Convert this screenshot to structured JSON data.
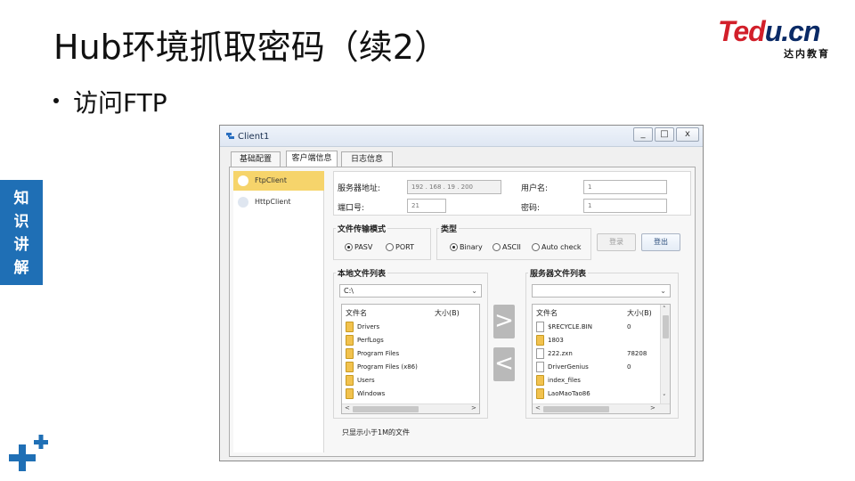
{
  "slide": {
    "title": "Hub环境抓取密码（续2）",
    "bullet": "访问FTP",
    "side_tab": [
      "知",
      "识",
      "讲",
      "解"
    ]
  },
  "logo": {
    "brand_red": "Ted",
    "brand_blue": "u.cn",
    "sub": "达内教育"
  },
  "window": {
    "title": "Client1",
    "controls": {
      "minimize": "_",
      "maximize": "□",
      "close": "x"
    },
    "tabs": [
      "基础配置",
      "客户端信息",
      "日志信息"
    ],
    "active_tab": 1,
    "clients": [
      {
        "label": "FtpClient",
        "selected": true
      },
      {
        "label": "HttpClient",
        "selected": false
      }
    ],
    "conn": {
      "server_label": "服务器地址:",
      "server_ip": "192 . 168 . 19 . 200",
      "port_label": "端口号:",
      "port_value": "21",
      "user_label": "用户名:",
      "user_value": "1",
      "pass_label": "密码:",
      "pass_value": "1"
    },
    "mode": {
      "title": "文件传输模式",
      "options": [
        "PASV",
        "PORT"
      ],
      "selected": "PASV"
    },
    "type": {
      "title": "类型",
      "options": [
        "Binary",
        "ASCII",
        "Auto check"
      ],
      "selected": "Binary"
    },
    "buttons": {
      "login": "登录",
      "logout": "登出"
    },
    "local": {
      "title": "本地文件列表",
      "path": "C:\\",
      "col_name": "文件名",
      "col_size": "大小(B)",
      "files": [
        {
          "name": "Drivers",
          "kind": "folder",
          "size": ""
        },
        {
          "name": "PerfLogs",
          "kind": "folder",
          "size": ""
        },
        {
          "name": "Program Files",
          "kind": "folder",
          "size": ""
        },
        {
          "name": "Program Files (x86)",
          "kind": "folder",
          "size": ""
        },
        {
          "name": "Users",
          "kind": "folder",
          "size": ""
        },
        {
          "name": "Windows",
          "kind": "folder",
          "size": ""
        }
      ]
    },
    "remote": {
      "title": "服务器文件列表",
      "path": "",
      "col_name": "文件名",
      "col_size": "大小(B)",
      "files": [
        {
          "name": "$RECYCLE.BIN",
          "kind": "file",
          "size": "0"
        },
        {
          "name": "1803",
          "kind": "folder",
          "size": ""
        },
        {
          "name": "222.zxn",
          "kind": "file",
          "size": "78208"
        },
        {
          "name": "DriverGenius",
          "kind": "file",
          "size": "0"
        },
        {
          "name": "index_files",
          "kind": "folder",
          "size": ""
        },
        {
          "name": "LaoMaoTao86",
          "kind": "folder",
          "size": ""
        }
      ]
    },
    "transfer": {
      "upload": ">",
      "download": "<"
    },
    "footnote": "只显示小于1M的文件"
  },
  "colors": {
    "accent_blue": "#1f6fb5",
    "selected_client": "#f6d46b",
    "brand_red": "#d21f2a",
    "brand_navy": "#0a2a66"
  }
}
